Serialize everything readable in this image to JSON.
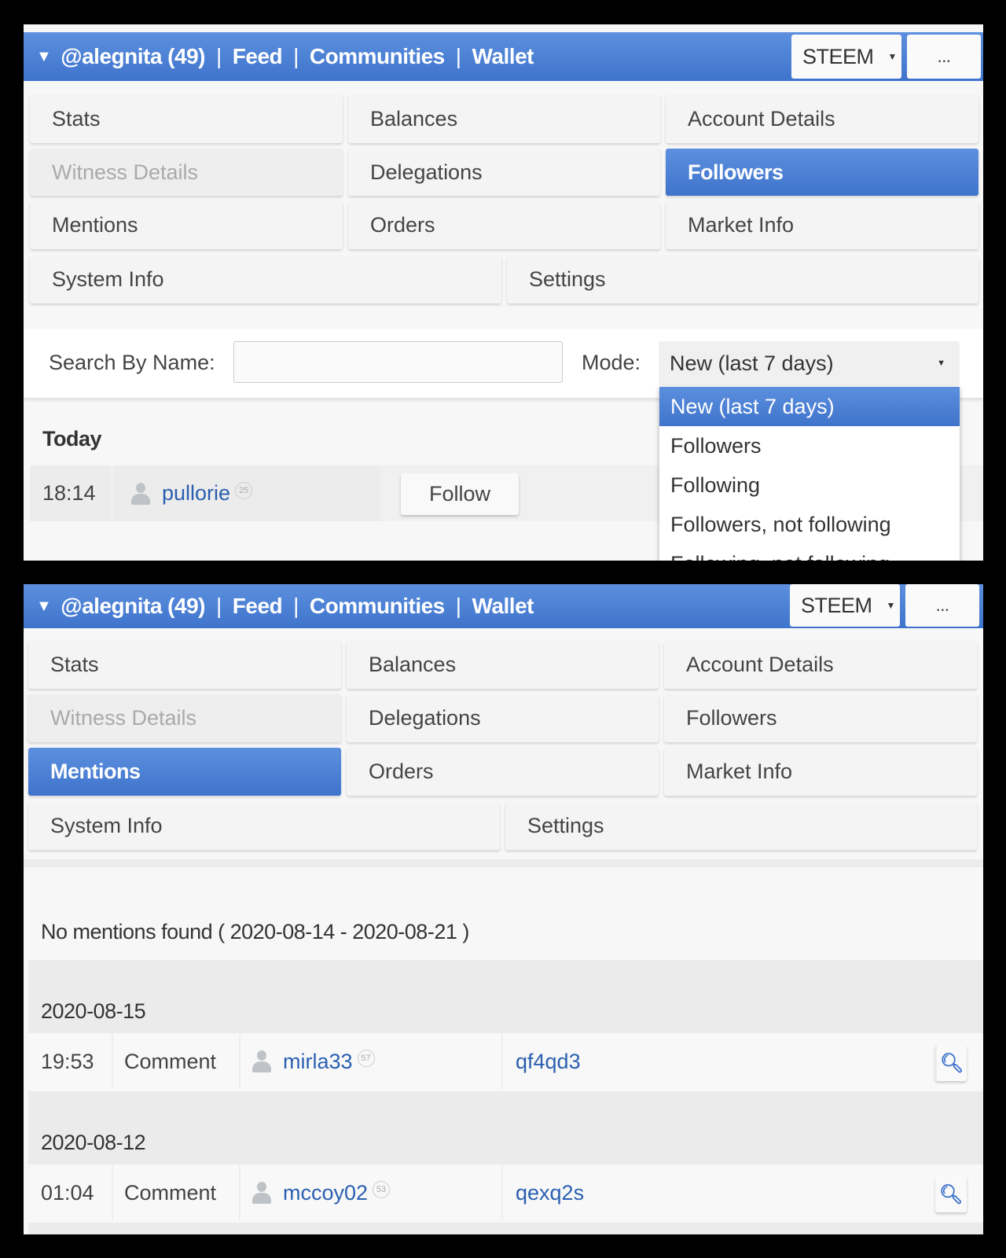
{
  "header": {
    "account": "@alegnita (49)",
    "links": [
      "Feed",
      "Communities",
      "Wallet"
    ],
    "currency": "STEEM",
    "more": "..."
  },
  "nav": {
    "items": [
      "Stats",
      "Balances",
      "Account Details",
      "Witness Details",
      "Delegations",
      "Followers",
      "Mentions",
      "Orders",
      "Market Info",
      "System Info",
      "Settings"
    ]
  },
  "screen1": {
    "active_tab": "Followers",
    "search_label": "Search By Name:",
    "search_value": "",
    "mode_label": "Mode:",
    "mode_value": "New (last 7 days)",
    "mode_options": [
      "New (last 7 days)",
      "Followers",
      "Following",
      "Followers, not following",
      "Following, not following"
    ],
    "group": "Today",
    "rows": [
      {
        "time": "18:14",
        "user": "pullorie",
        "rep": "25",
        "action": "Follow"
      }
    ]
  },
  "screen2": {
    "active_tab": "Mentions",
    "notice": "No mentions found ( 2020-08-14 - 2020-08-21 )",
    "groups": [
      {
        "date": "2020-08-15",
        "time": "19:53",
        "type": "Comment",
        "user": "mirla33",
        "rep": "57",
        "link": "qf4qd3"
      },
      {
        "date": "2020-08-12",
        "time": "01:04",
        "type": "Comment",
        "user": "mccoy02",
        "rep": "53",
        "link": "qexq2s"
      }
    ]
  },
  "colors": {
    "accent": "#4a7fd4",
    "link": "#2a5fb0"
  }
}
